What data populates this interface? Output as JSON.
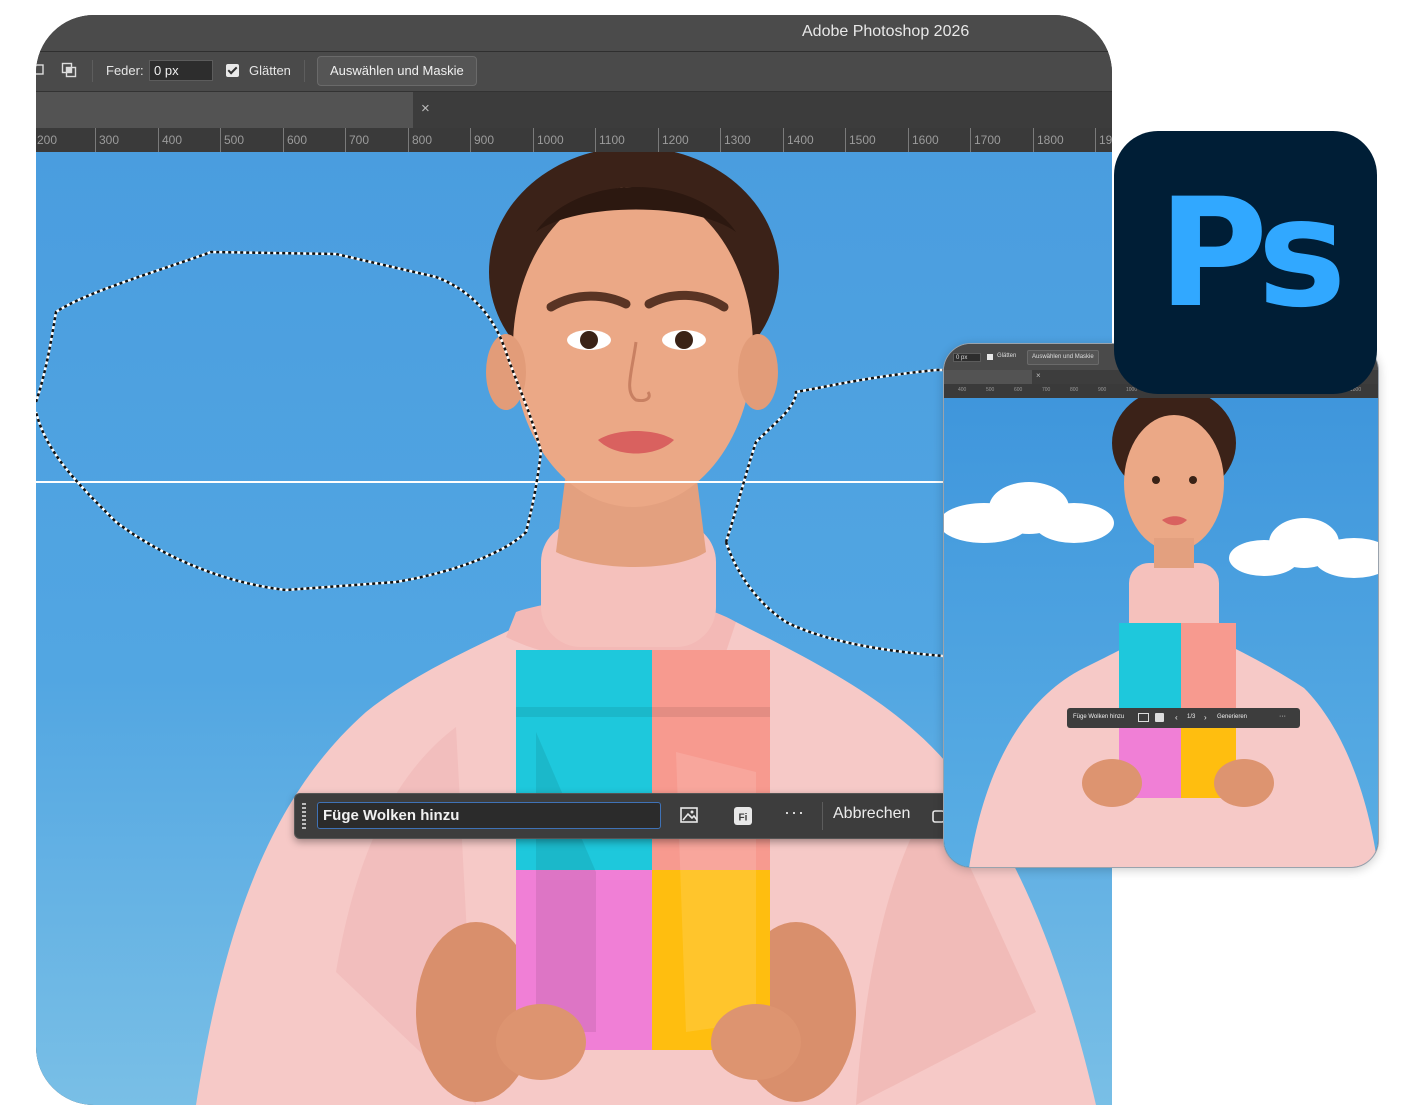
{
  "app": {
    "title": "Adobe Photoshop 2026"
  },
  "options_bar": {
    "feather_label": "Feder:",
    "feather_value": "0 px",
    "smooth_label": "Glätten",
    "smooth_checked": true,
    "select_mask_label": "Auswählen und Maskie"
  },
  "ruler": {
    "labels": [
      "200",
      "300",
      "400",
      "500",
      "600",
      "700",
      "800",
      "900",
      "1000",
      "1100",
      "1200",
      "1300",
      "1400",
      "1500",
      "1600",
      "1700",
      "1800",
      "19"
    ]
  },
  "contextual_taskbar": {
    "prompt_value": "Füge Wolken hinzu",
    "cancel_label": "Abbrechen",
    "more_label": "···"
  },
  "preview_window": {
    "feather_value": "0 px",
    "smooth_label": "Glätten",
    "select_mask_label": "Auswählen und Maskie",
    "ruler_labels": [
      "400",
      "500",
      "600",
      "700",
      "800",
      "900",
      "1000",
      "1100",
      "1200",
      "1300",
      "1400",
      "1500",
      "1600",
      "1700",
      "1800"
    ],
    "prompt_value": "Füge Wolken hinzu",
    "variation_counter": "1/3",
    "generate_label": "Generieren"
  },
  "logo": {
    "text": "Ps",
    "background": "#001e36",
    "color": "#31a8ff"
  },
  "colors": {
    "sky": "#4a9ddf",
    "sweater": "#f6c9c7",
    "bag_cyan": "#1ec8dc",
    "bag_coral": "#f79a8f",
    "bag_pink": "#f07fd6",
    "bag_yellow": "#ffbe0f",
    "selection_line": "#ffffff"
  }
}
